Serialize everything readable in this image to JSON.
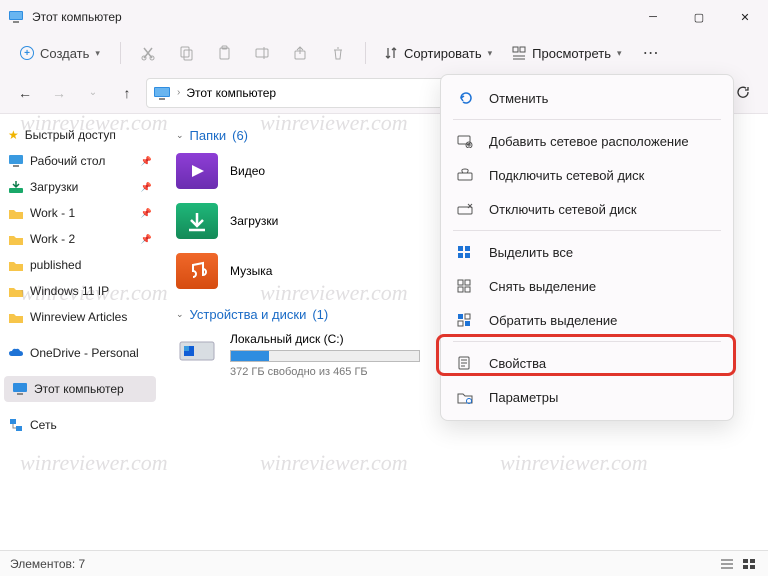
{
  "window": {
    "title": "Этот компьютер"
  },
  "toolbar": {
    "new_label": "Создать",
    "sort_label": "Сортировать",
    "view_label": "Просмотреть"
  },
  "path": {
    "location": "Этот компьютер"
  },
  "sidebar": {
    "items": [
      {
        "label": "Быстрый доступ"
      },
      {
        "label": "Рабочий стол"
      },
      {
        "label": "Загрузки"
      },
      {
        "label": "Work - 1"
      },
      {
        "label": "Work - 2"
      },
      {
        "label": "published"
      },
      {
        "label": "Windows 11 IP"
      },
      {
        "label": "Winreview Articles"
      }
    ],
    "onedrive": "OneDrive - Personal",
    "thispc": "Этот компьютер",
    "network": "Сеть"
  },
  "groups": {
    "folders": {
      "title": "Папки",
      "count": "(6)"
    },
    "drives": {
      "title": "Устройства и диски",
      "count": "(1)"
    }
  },
  "folders": [
    {
      "label": "Видео"
    },
    {
      "label": "Загрузки"
    },
    {
      "label": "Музыка"
    }
  ],
  "drive": {
    "name": "Локальный диск (C:)",
    "free_text": "372 ГБ свободно из 465 ГБ",
    "fill_pct": 20
  },
  "menu": {
    "items": [
      "Отменить",
      "Добавить сетевое расположение",
      "Подключить сетевой диск",
      "Отключить сетевой диск",
      "Выделить все",
      "Снять выделение",
      "Обратить выделение",
      "Свойства",
      "Параметры"
    ]
  },
  "status": {
    "elements": "Элементов: 7"
  },
  "watermark": "winreviewer.com"
}
